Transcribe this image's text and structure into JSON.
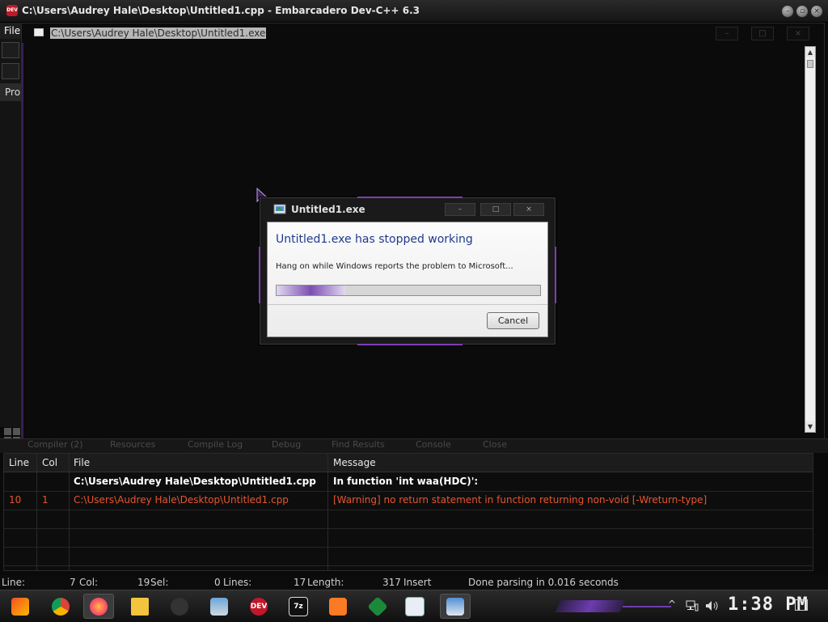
{
  "ide": {
    "title": "C:\\Users\\Audrey Hale\\Desktop\\Untitled1.cpp - Embarcadero Dev-C++ 6.3",
    "icon_label": "DEV",
    "menu_file": "File",
    "project_tab": "Pro"
  },
  "console": {
    "title": "C:\\Users\\Audrey Hale\\Desktop\\Untitled1.exe",
    "minimize": "–",
    "maximize": "□",
    "close": "×"
  },
  "dialog": {
    "title": "Untitled1.exe",
    "heading": "Untitled1.exe has stopped working",
    "message": "Hang on while Windows reports the problem to Microsoft...",
    "progress_fraction": 0.26,
    "cancel_label": "Cancel",
    "minimize": "–",
    "maximize": "□",
    "close": "×",
    "accent_color": "#7b3fb4"
  },
  "bottom_tabs": [
    "Compiler (2)",
    "Resources",
    "Compile Log",
    "Debug",
    "Find Results",
    "Console",
    "Close"
  ],
  "messages": {
    "headers": [
      "Line",
      "Col",
      "File",
      "Message"
    ],
    "rows": [
      {
        "line": "",
        "col": "",
        "file": "C:\\Users\\Audrey Hale\\Desktop\\Untitled1.cpp",
        "message": "In function 'int waa(HDC)':"
      },
      {
        "line": "10",
        "col": "1",
        "file": "C:\\Users\\Audrey Hale\\Desktop\\Untitled1.cpp",
        "message": "[Warning] no return statement in function returning non-void [-Wreturn-type]"
      }
    ]
  },
  "status": {
    "line_label": "Line:",
    "line_value": "7",
    "col_label": "Col:",
    "col_value": "19",
    "sel_label": "Sel:",
    "sel_value": "0",
    "lines_label": "Lines:",
    "lines_value": "17",
    "length_label": "Length:",
    "length_value": "317",
    "mode": "Insert",
    "message": "Done parsing in 0.016 seconds"
  },
  "taskbar": {
    "icons": [
      "start-icon",
      "chrome-icon",
      "firefox-icon",
      "file-explorer-icon",
      "tool-icon",
      "photos-icon",
      "devcpp-icon",
      "7zip-icon",
      "xampp-icon",
      "app-green-icon",
      "notepad-icon",
      "untitled1-exe-icon"
    ],
    "clock": "1:38 PM",
    "tray_chevron": "^"
  }
}
